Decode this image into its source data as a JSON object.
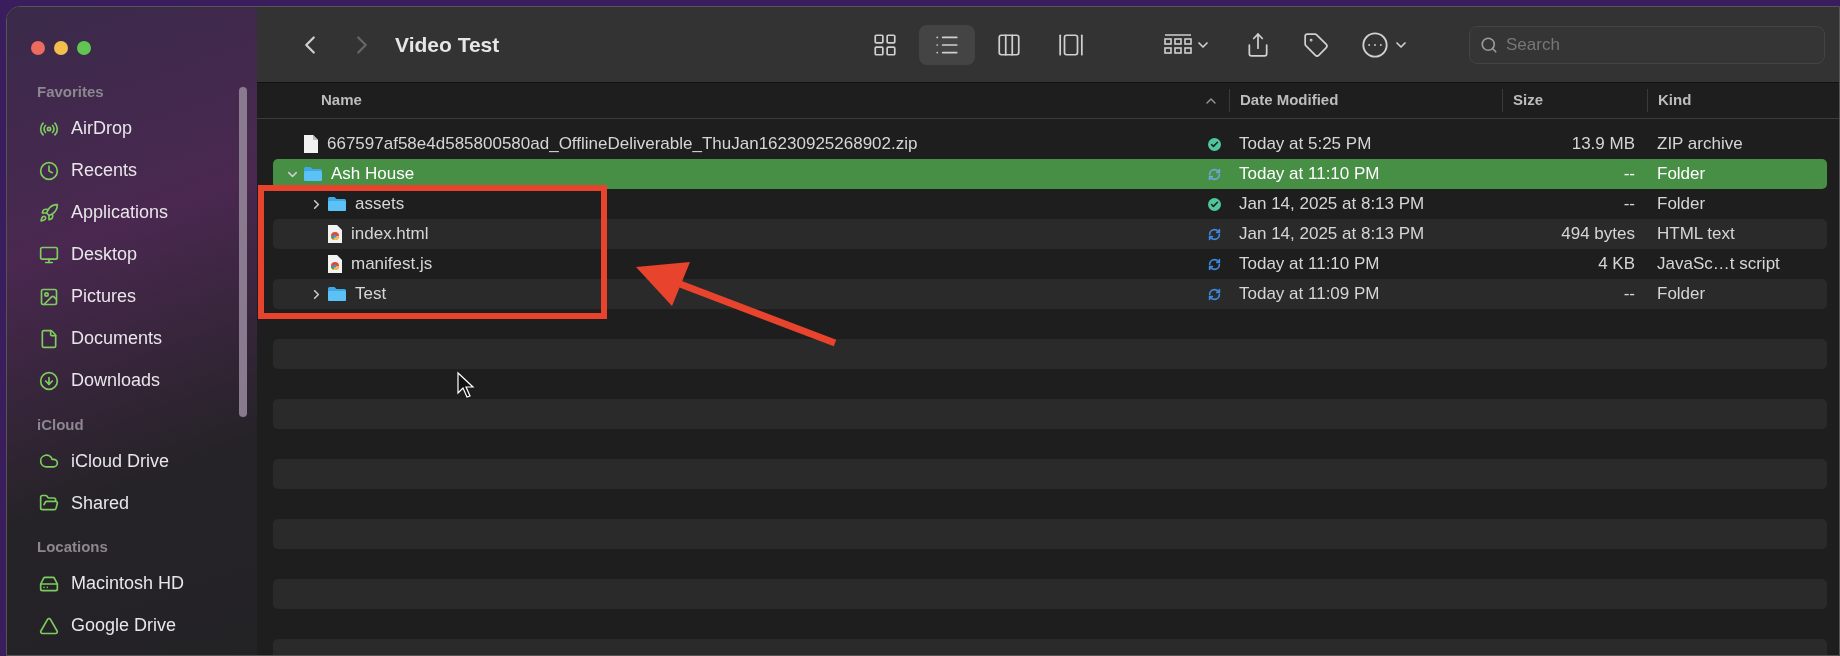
{
  "window": {
    "title": "Video Test"
  },
  "toolbar": {
    "views": [
      {
        "selected": false
      },
      {
        "selected": true
      },
      {
        "selected": false
      },
      {
        "selected": false
      }
    ],
    "search": {
      "placeholder": "Search"
    }
  },
  "sidebar": {
    "sections": [
      {
        "title": "Favorites",
        "items": [
          {
            "label": "AirDrop"
          },
          {
            "label": "Recents"
          },
          {
            "label": "Applications"
          },
          {
            "label": "Desktop"
          },
          {
            "label": "Pictures"
          },
          {
            "label": "Documents"
          },
          {
            "label": "Downloads"
          }
        ]
      },
      {
        "title": "iCloud",
        "items": [
          {
            "label": "iCloud Drive"
          },
          {
            "label": "Shared"
          }
        ]
      },
      {
        "title": "Locations",
        "items": [
          {
            "label": "Macintosh HD"
          },
          {
            "label": "Google Drive"
          }
        ]
      }
    ]
  },
  "table": {
    "columns": [
      "Name",
      "Date Modified",
      "Size",
      "Kind"
    ],
    "rows": [
      {
        "name": "667597af58e4d585800580ad_OfflineDeliverable_ThuJan16230925268902.zip",
        "kind": "file",
        "synced": true,
        "date": "Today at 5:25 PM",
        "size": "13.9 MB",
        "type": "ZIP archive",
        "selected": false
      },
      {
        "name": "Ash House",
        "kind": "folder",
        "expanded": true,
        "synced": false,
        "date": "Today at 11:10 PM",
        "size": "--",
        "type": "Folder",
        "selected": true,
        "children": [
          {
            "name": "assets",
            "kind": "folder",
            "expanded": false,
            "synced": true,
            "date": "Jan 14, 2025 at 8:13 PM",
            "size": "--",
            "type": "Folder",
            "selected": false
          },
          {
            "name": "index.html",
            "kind": "web",
            "synced": false,
            "date": "Jan 14, 2025 at 8:13 PM",
            "size": "494 bytes",
            "type": "HTML text",
            "selected": false
          },
          {
            "name": "manifest.js",
            "kind": "web",
            "synced": false,
            "date": "Today at 11:10 PM",
            "size": "4 KB",
            "type": "JavaSc…t script",
            "selected": false
          },
          {
            "name": "Test",
            "kind": "folder",
            "expanded": false,
            "synced": false,
            "date": "Today at 11:09 PM",
            "size": "--",
            "type": "Folder",
            "selected": false
          }
        ]
      }
    ]
  }
}
